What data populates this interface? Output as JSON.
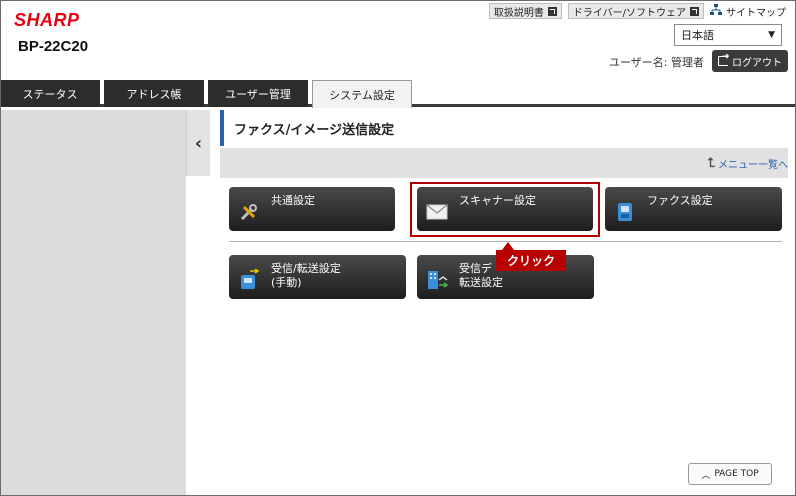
{
  "header": {
    "brand": "SHARP",
    "model": "BP-22C20",
    "links": [
      {
        "label": "取扱説明書"
      },
      {
        "label": "ドライバー/ソフトウェア"
      }
    ],
    "sitemap_label": "サイトマップ",
    "language_value": "日本語",
    "user_label": "ユーザー名: 管理者",
    "logout_label": "ログアウト"
  },
  "tabs": [
    {
      "label": "ステータス"
    },
    {
      "label": "アドレス帳"
    },
    {
      "label": "ユーザー管理"
    },
    {
      "label": "システム設定"
    }
  ],
  "main": {
    "title": "ファクス/イメージ送信設定",
    "menu_list_label": "メニュー一覧へ",
    "buttons": {
      "common": "共通設定",
      "scanner": "スキャナー設定",
      "fax": "ファクス設定",
      "receive_forward_line1": "受信/転送設定",
      "receive_forward_line2": "(手動)",
      "receive_data_line1": "受信デ",
      "receive_data_line2": "転送設定"
    },
    "callout": "クリック",
    "page_top": "PAGE TOP"
  },
  "colors": {
    "accent_blue": "#2a62b0",
    "brand_red": "#e60012",
    "highlight_red": "#b80000"
  },
  "icons": [
    "external-link-icon",
    "sitemap-icon",
    "logout-icon",
    "chevron-left-icon",
    "return-arrow-icon",
    "tools-icon",
    "envelope-icon",
    "fax-icon",
    "inbox-forward-icon",
    "building-forward-icon",
    "chevron-up-icon"
  ]
}
